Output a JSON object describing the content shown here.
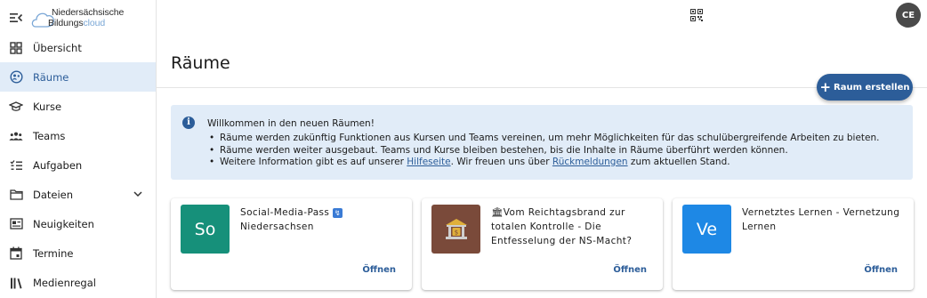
{
  "logo": {
    "line1": "Niedersächsische",
    "line2_a": "Bildungs",
    "line2_b": "cloud"
  },
  "sidebar": {
    "items": [
      {
        "label": "Übersicht",
        "icon": "dashboard-icon"
      },
      {
        "label": "Räume",
        "icon": "rooms-icon",
        "active": true
      },
      {
        "label": "Kurse",
        "icon": "graduation-cap-icon"
      },
      {
        "label": "Teams",
        "icon": "people-icon"
      },
      {
        "label": "Aufgaben",
        "icon": "tasks-icon"
      },
      {
        "label": "Dateien",
        "icon": "folder-icon",
        "expandable": true
      },
      {
        "label": "Neuigkeiten",
        "icon": "news-icon"
      },
      {
        "label": "Termine",
        "icon": "calendar-icon"
      },
      {
        "label": "Medienregal",
        "icon": "bookshelf-icon"
      }
    ]
  },
  "header": {
    "avatar_initials": "CE",
    "qr_icon": "qr-code-icon"
  },
  "main": {
    "title": "Räume",
    "create_button": "Raum erstellen",
    "alert": {
      "title": "Willkommen in den neuen Räumen!",
      "line1": "Räume werden zukünftig Funktionen aus Kursen und Teams vereinen, um mehr Möglichkeiten für das schulübergreifende Arbeiten zu bieten.",
      "line2": "Räume werden weiter ausgebaut. Teams und Kurse bleiben bestehen, bis die Inhalte in Räume überführt werden können.",
      "line3_a": "Weitere Information gibt es auf unserer ",
      "line3_link1": "Hilfeseite",
      "line3_b": ". Wir freuen uns über ",
      "line3_link2": "Rückmeldungen",
      "line3_c": " zum aktuellen Stand."
    },
    "cards": [
      {
        "thumb_text": "So",
        "thumb_color": "#16907a",
        "title": "Social-Media-Pass",
        "title_emoji": "↯",
        "title_2": "Niedersachsen",
        "open_label": "Öffnen"
      },
      {
        "thumb_text": "",
        "thumb_color": "#7a4a3a",
        "title_prefix": "🏛",
        "title": "Vom Reichtagsbrand zur totalen Kontrolle - Die Entfesselung der NS-Macht?",
        "open_label": "Öffnen"
      },
      {
        "thumb_text": "Ve",
        "thumb_color": "#1e88e5",
        "title": "Vernetztes Lernen - Vernetzung Lernen",
        "open_label": "Öffnen"
      }
    ]
  },
  "colors": {
    "primary": "#2c5d99",
    "active_bg": "#e1ecf8",
    "alert_bg": "#e1ecf8"
  }
}
